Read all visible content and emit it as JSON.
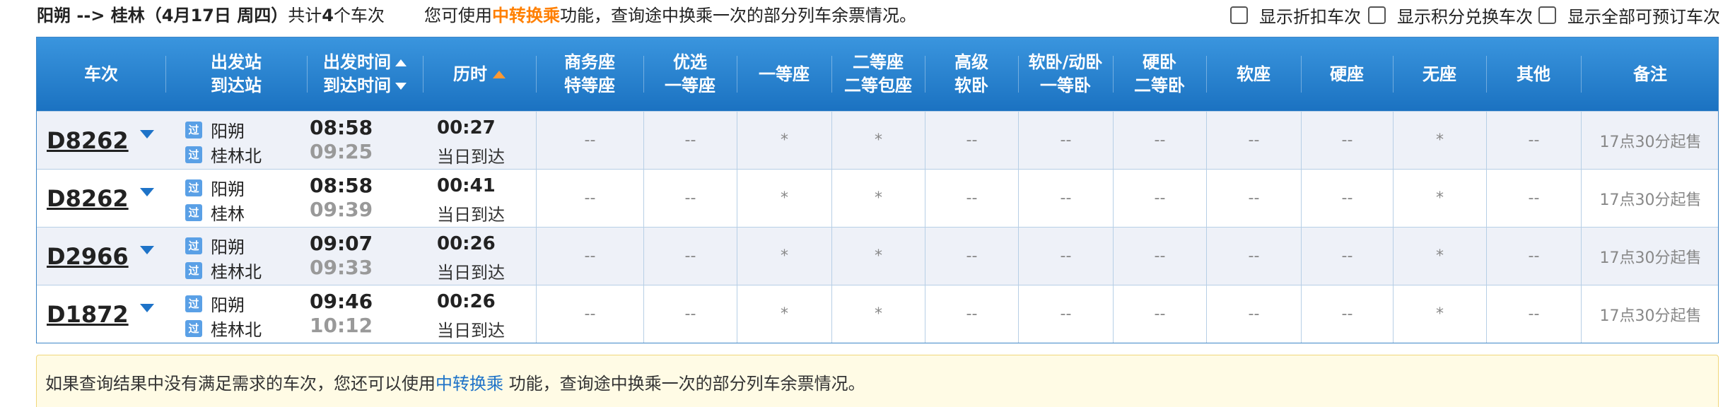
{
  "header": {
    "route_part1": "阳朔 --> 桂林（4月17日 周四）",
    "route_prefix": "共计",
    "route_count": "4",
    "route_suffix": "个车次",
    "info_prefix": "您可使用",
    "info_link": "中转换乘",
    "info_suffix": "功能，查询途中换乘一次的部分列车余票情况。",
    "options": [
      "显示折扣车次",
      "显示积分兑换车次",
      "显示全部可预订车次"
    ]
  },
  "columns": {
    "train": "车次",
    "station_top": "出发站",
    "station_bottom": "到达站",
    "time_top": "出发时间",
    "time_bottom": "到达时间",
    "duration": "历时",
    "biz_top": "商务座",
    "biz_bottom": "特等座",
    "pref_top": "优选",
    "pref_bottom": "一等座",
    "first": "一等座",
    "second_top": "二等座",
    "second_bottom": "二等包座",
    "soft_top": "高级",
    "soft_bottom": "软卧",
    "sleeper_top": "软卧/动卧",
    "sleeper_bottom": "一等卧",
    "hard_top": "硬卧",
    "hard_bottom": "二等卧",
    "soft_seat": "软座",
    "hard_seat": "硬座",
    "no_seat": "无座",
    "other": "其他",
    "remark": "备注"
  },
  "trains": [
    {
      "no": "D8262",
      "badge": "过",
      "from": "阳朔",
      "to": "桂林北",
      "dep": "08:58",
      "arr": "09:25",
      "dur": "00:27",
      "arrive_note": "当日到达",
      "seats": [
        "--",
        "--",
        "*",
        "*",
        "--",
        "--",
        "--",
        "--",
        "--",
        "*",
        "--"
      ],
      "remark": "17点30分起售"
    },
    {
      "no": "D8262",
      "badge": "过",
      "from": "阳朔",
      "to": "桂林",
      "dep": "08:58",
      "arr": "09:39",
      "dur": "00:41",
      "arrive_note": "当日到达",
      "seats": [
        "--",
        "--",
        "*",
        "*",
        "--",
        "--",
        "--",
        "--",
        "--",
        "*",
        "--"
      ],
      "remark": "17点30分起售"
    },
    {
      "no": "D2966",
      "badge": "过",
      "from": "阳朔",
      "to": "桂林北",
      "dep": "09:07",
      "arr": "09:33",
      "dur": "00:26",
      "arrive_note": "当日到达",
      "seats": [
        "--",
        "--",
        "*",
        "*",
        "--",
        "--",
        "--",
        "--",
        "--",
        "*",
        "--"
      ],
      "remark": "17点30分起售"
    },
    {
      "no": "D1872",
      "badge": "过",
      "from": "阳朔",
      "to": "桂林北",
      "dep": "09:46",
      "arr": "10:12",
      "dur": "00:26",
      "arrive_note": "当日到达",
      "seats": [
        "--",
        "--",
        "*",
        "*",
        "--",
        "--",
        "--",
        "--",
        "--",
        "*",
        "--"
      ],
      "remark": "17点30分起售"
    }
  ],
  "notice": {
    "prefix": "如果查询结果中没有满足需求的车次，您还可以使用",
    "link": "中转换乘",
    "suffix": " 功能，查询途中换乘一次的部分列车余票情况。"
  }
}
